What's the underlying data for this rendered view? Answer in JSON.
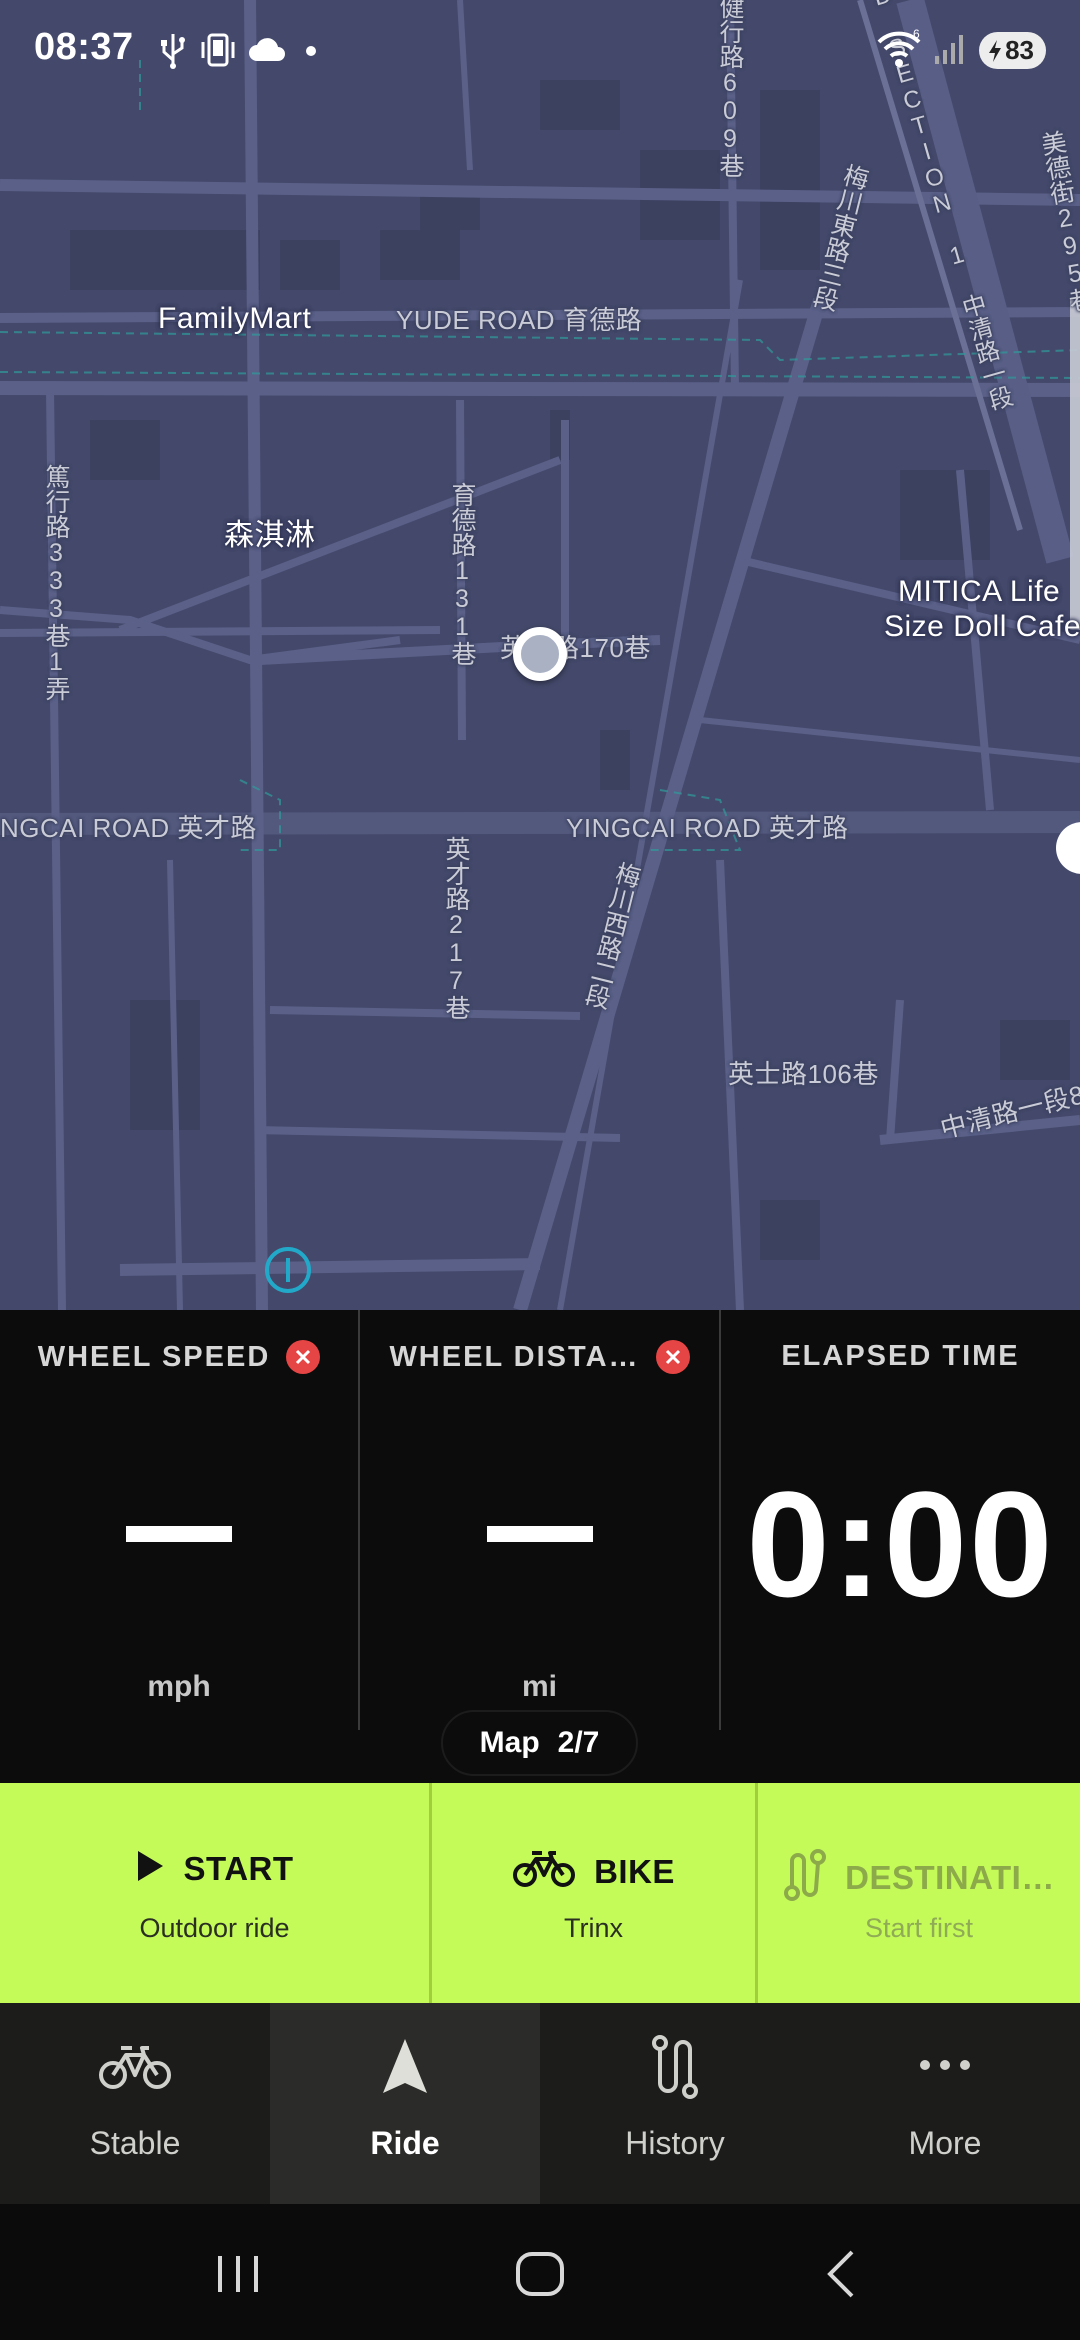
{
  "status_bar": {
    "time": "08:37",
    "battery": "83",
    "icons": [
      "usb-icon",
      "phone-vibrate-icon",
      "cloud-icon",
      "dot-icon",
      "wifi-icon",
      "signal-icon",
      "battery-charging-icon"
    ]
  },
  "map": {
    "labels": {
      "familymart": "FamilyMart",
      "yude_road": "YUDE ROAD 育德路",
      "senqilin": "森淇淋",
      "mitica_line1": "MITICA Life",
      "mitica_line2": "Size Doll Cafe",
      "lane_170": "英才路170巷",
      "yingcai_road_left": "NGCAI ROAD 英才路",
      "yingcai_road_right": "YINGCAI ROAD 英才路",
      "lane_106": "英士路106巷",
      "zhongqing_road": "中清路一段8",
      "yude_131": "育德路131巷",
      "duxing_333": "篤行路333巷1弄",
      "yingcai_217": "英才路217巷",
      "meichuan_west": "梅川西路二段",
      "meichuan_east": "梅川東路三段",
      "zhongqing_section": "D SECTION 1 中清路一段",
      "meide_295": "美德街295巷",
      "jianxing_609": "健行路609巷"
    }
  },
  "stats": {
    "wheel_speed": {
      "title": "WHEEL SPEED",
      "value": "—",
      "unit": "mph"
    },
    "wheel_distance": {
      "title": "WHEEL DISTA…",
      "value": "—",
      "unit": "mi"
    },
    "elapsed_time": {
      "title": "ELAPSED TIME",
      "value": "0:00"
    },
    "page_indicator": {
      "label": "Map",
      "page": "2/7"
    }
  },
  "actions": {
    "start": {
      "label": "START",
      "sub": "Outdoor ride"
    },
    "bike": {
      "label": "BIKE",
      "sub": "Trinx"
    },
    "destination": {
      "label": "DESTINATI…",
      "sub": "Start first"
    }
  },
  "colors": {
    "accent": "#c4fb58",
    "map_bg": "#44496b",
    "error": "#e64545"
  },
  "bottom_nav": {
    "items": [
      {
        "label": "Stable",
        "icon": "bike-icon"
      },
      {
        "label": "Ride",
        "icon": "navigation-arrow-icon",
        "active": true
      },
      {
        "label": "History",
        "icon": "route-icon"
      },
      {
        "label": "More",
        "icon": "more-dots-icon"
      }
    ]
  }
}
